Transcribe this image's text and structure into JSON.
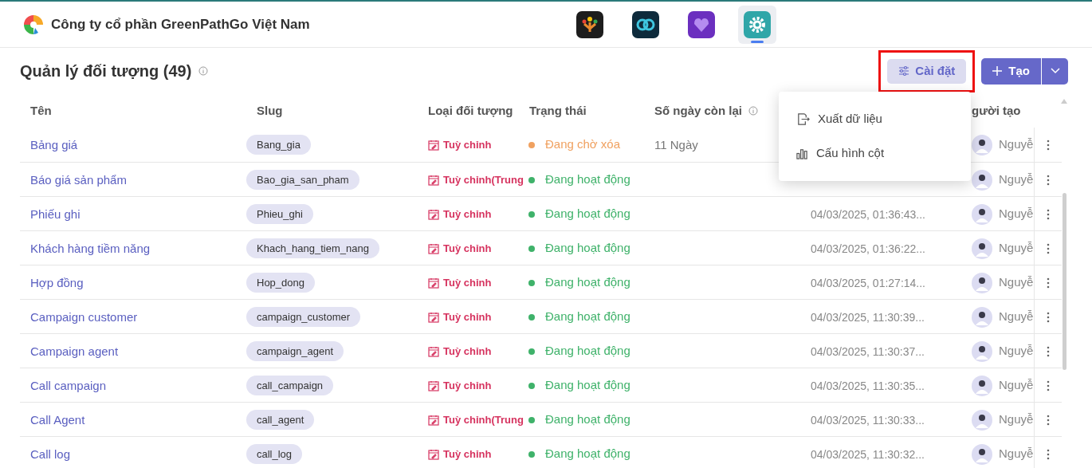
{
  "header": {
    "company": "Công ty cổ phần GreenPathGo Việt Nam",
    "apps": [
      {
        "kind": "people",
        "selected": false
      },
      {
        "kind": "link",
        "selected": false
      },
      {
        "kind": "heart",
        "selected": false
      },
      {
        "kind": "gear",
        "selected": true
      }
    ]
  },
  "page": {
    "title": "Quản lý đối tượng (49)",
    "settings_button": "Cài đặt",
    "create_button": "Tạo"
  },
  "menu": {
    "items": [
      {
        "kind": "export",
        "label": "Xuất dữ liệu"
      },
      {
        "kind": "columns",
        "label": "Cấu hình cột"
      }
    ]
  },
  "table": {
    "columns": [
      "Tên",
      "Slug",
      "Loại đối tượng",
      "Trạng thái",
      "Số ngày còn lại",
      "gười tạo"
    ],
    "rows": [
      {
        "name": "Bảng giá",
        "slug": "Bang_gia",
        "type": "Tuỳ chỉnh",
        "color": "#f0a160",
        "status_text": "Đang chờ xóa",
        "days": "11 Ngày",
        "creator": "Nguyễ"
      },
      {
        "name": "Báo giá sản phẩm",
        "slug": "Bao_gia_san_pham",
        "type": "Tuỳ chỉnh(Trung",
        "color": "#3fb26a",
        "status_text": "Đang hoạt động",
        "creator": "Nguyễ"
      },
      {
        "name": "Phiếu ghi",
        "slug": "Phieu_ghi",
        "type": "Tuỳ chỉnh",
        "color": "#3fb26a",
        "status_text": "Đang hoạt động",
        "created": "04/03/2025, 01:36:43...",
        "creator": "Nguyễ"
      },
      {
        "name": "Khách hàng tiềm năng",
        "slug": "Khach_hang_tiem_nang",
        "type": "Tuỳ chỉnh",
        "color": "#3fb26a",
        "status_text": "Đang hoạt động",
        "created": "04/03/2025, 01:36:22...",
        "creator": "Nguyễ"
      },
      {
        "name": "Hợp đồng",
        "slug": "Hop_dong",
        "type": "Tuỳ chỉnh",
        "color": "#3fb26a",
        "status_text": "Đang hoạt động",
        "created": "04/03/2025, 01:27:14...",
        "creator": "Nguyễ"
      },
      {
        "name": "Campaign customer",
        "slug": "campaign_customer",
        "type": "Tuỳ chỉnh",
        "color": "#3fb26a",
        "status_text": "Đang hoạt động",
        "created": "04/03/2025, 11:30:39...",
        "creator": "Nguyễ"
      },
      {
        "name": "Campaign agent",
        "slug": "campaign_agent",
        "type": "Tuỳ chỉnh",
        "color": "#3fb26a",
        "status_text": "Đang hoạt động",
        "created": "04/03/2025, 11:30:37...",
        "creator": "Nguyễ"
      },
      {
        "name": "Call campaign",
        "slug": "call_campaign",
        "type": "Tuỳ chỉnh",
        "color": "#3fb26a",
        "status_text": "Đang hoạt động",
        "created": "04/03/2025, 11:30:35...",
        "creator": "Nguyễ"
      },
      {
        "name": "Call Agent",
        "slug": "call_agent",
        "type": "Tuỳ chỉnh(Trung",
        "color": "#3fb26a",
        "status_text": "Đang hoạt động",
        "created": "04/03/2025, 11:30:33...",
        "creator": "Nguyễ"
      },
      {
        "name": "Call log",
        "slug": "call_log",
        "type": "Tuỳ chỉnh",
        "color": "#3fb26a",
        "status_text": "Đang hoạt động",
        "created": "04/03/2025, 11:30:32...",
        "creator": "Nguyễ"
      }
    ]
  }
}
